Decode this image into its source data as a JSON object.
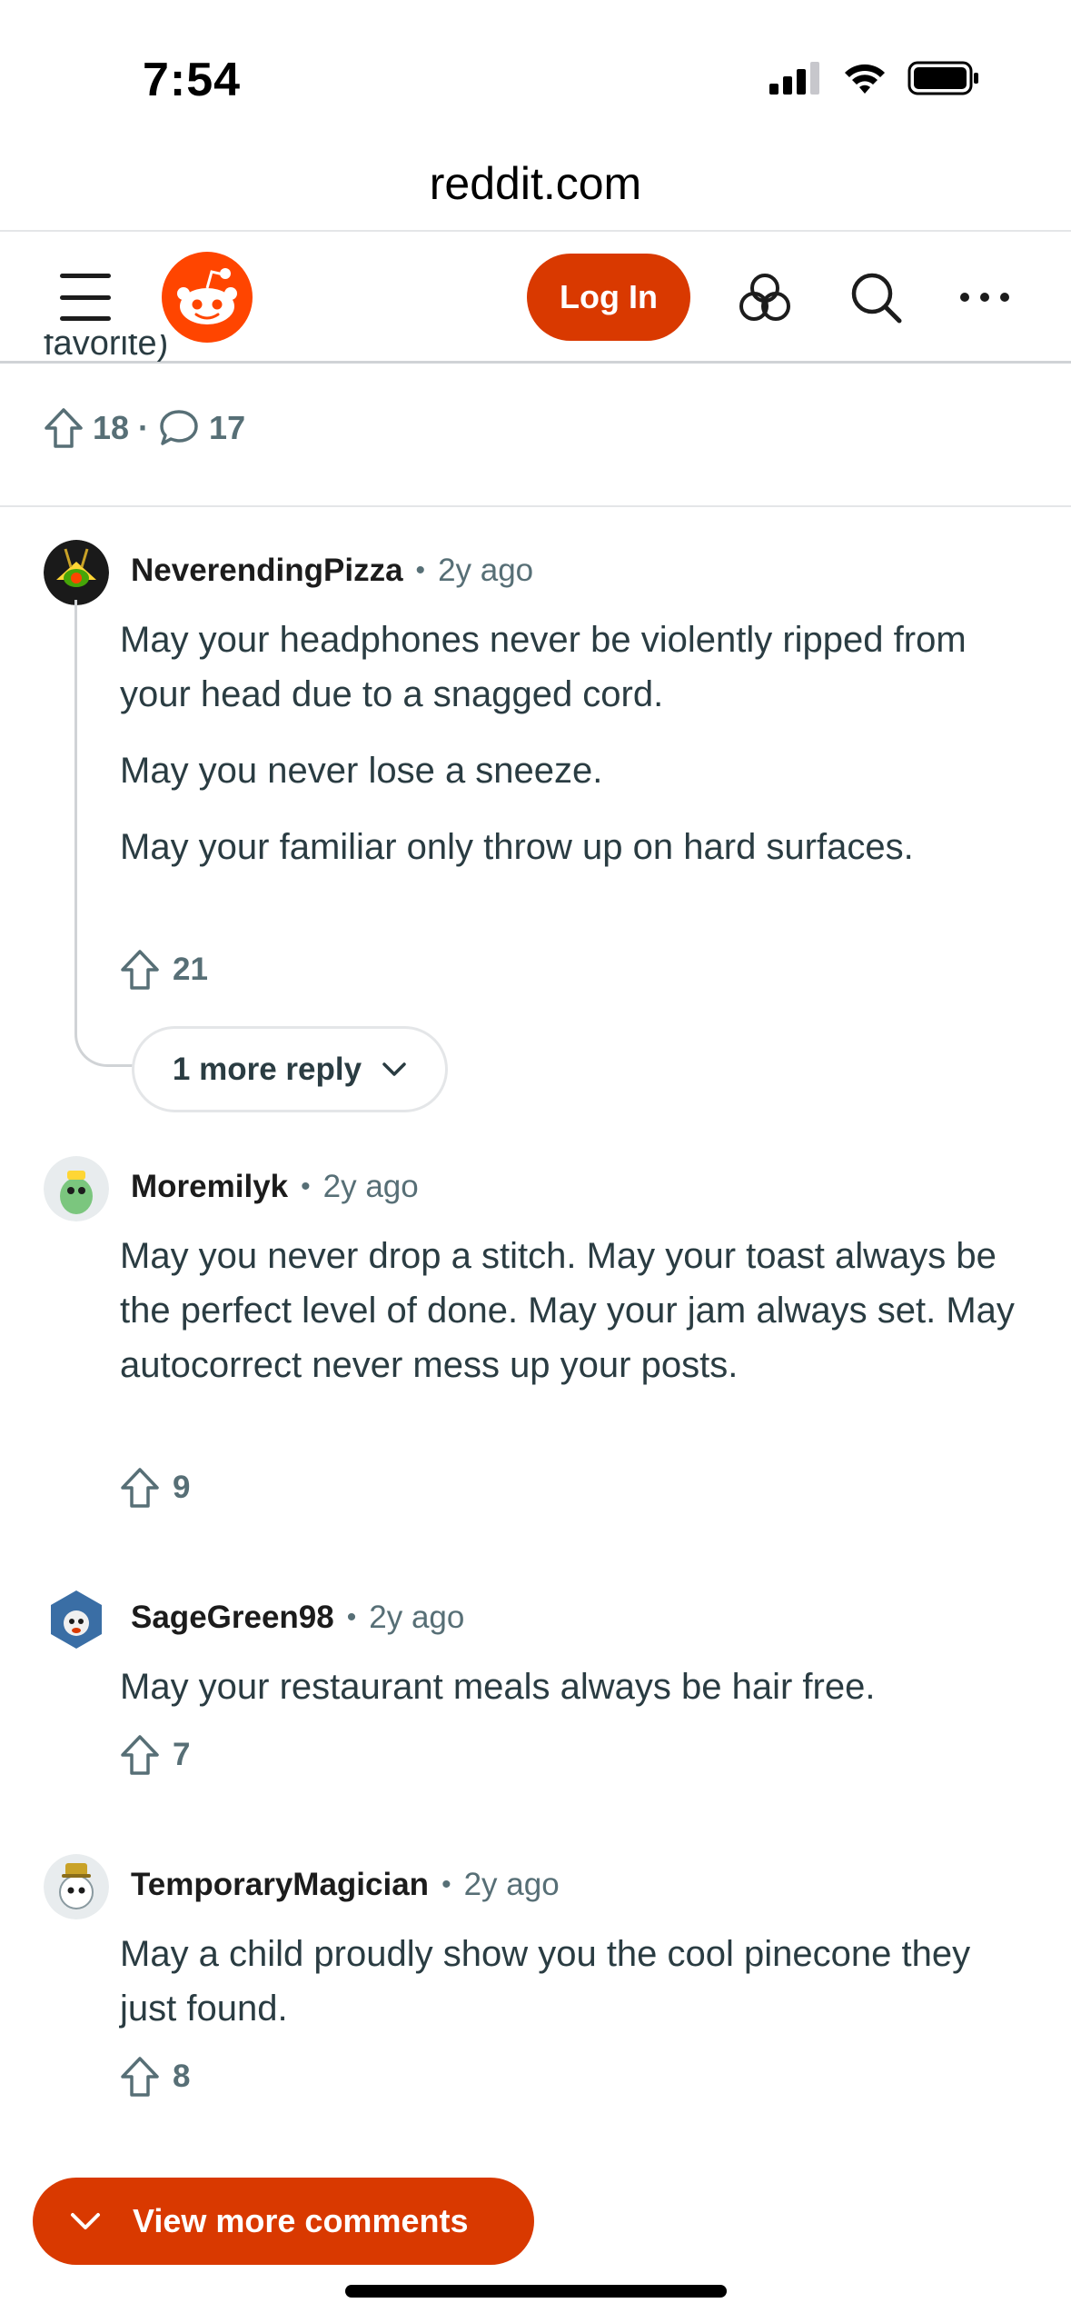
{
  "status_bar": {
    "time": "7:54"
  },
  "browser": {
    "url": "reddit.com"
  },
  "header": {
    "login_label": "Log In"
  },
  "previous_post": {
    "partial_text": "favorite)",
    "upvotes": "18",
    "separator": "·",
    "comments": "17"
  },
  "comments": [
    {
      "author": "NeverendingPizza",
      "time": "2y ago",
      "paragraphs": [
        "May your headphones never be violently ripped from your head due to a snagged cord.",
        "May you never lose a sneeze.",
        "May your familiar only throw up on hard surfaces."
      ],
      "upvotes": "21",
      "more_replies_label": "1 more reply"
    },
    {
      "author": "Moremilyk",
      "time": "2y ago",
      "paragraphs": [
        "May you never drop a stitch. May your toast always be the perfect level of done. May your jam always set. May autocorrect never mess up your posts."
      ],
      "upvotes": "9"
    },
    {
      "author": "SageGreen98",
      "time": "2y ago",
      "paragraphs": [
        "May your restaurant meals always be hair free."
      ],
      "upvotes": "7"
    },
    {
      "author": "TemporaryMagician",
      "time": "2y ago",
      "paragraphs": [
        "May a child proudly show you the cool pinecone they just found."
      ],
      "upvotes": "8"
    }
  ],
  "view_more_label": "View more comments",
  "colors": {
    "accent": "#d93900",
    "meta": "#576f76",
    "body": "#2a3c42"
  },
  "icons": [
    "signal-icon",
    "wifi-icon",
    "battery-icon",
    "menu-icon",
    "reddit-logo",
    "popular-icon",
    "search-icon",
    "more-icon",
    "upvote-icon",
    "comment-icon",
    "chevron-down-icon"
  ]
}
